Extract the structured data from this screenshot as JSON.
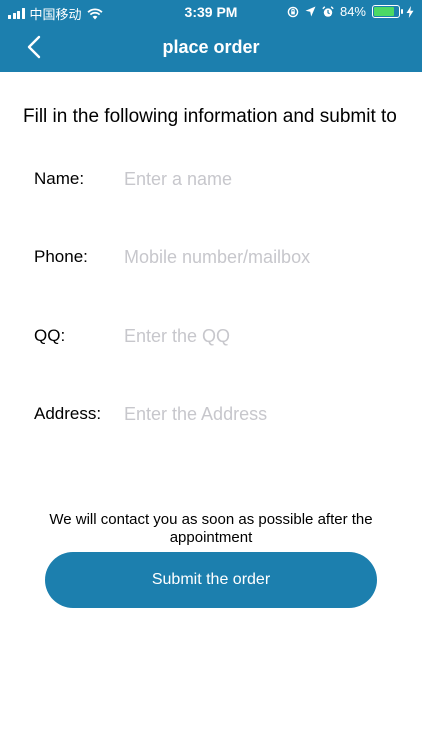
{
  "status_bar": {
    "carrier": "中国移动",
    "time": "3:39 PM",
    "battery": "84%",
    "battery_level": 0.84
  },
  "navbar": {
    "title": "place order",
    "back_icon": "chevron-left-icon"
  },
  "form": {
    "intro": "Fill in the following information and submit to",
    "fields": [
      {
        "label": "Name:",
        "placeholder": "Enter a name"
      },
      {
        "label": "Phone:",
        "placeholder": "Mobile number/mailbox"
      },
      {
        "label": "QQ:",
        "placeholder": "Enter the QQ"
      },
      {
        "label": "Address:",
        "placeholder": "Enter the Address"
      }
    ],
    "notice": "We will contact you as soon as possible after the appointment",
    "submit_label": "Submit the order"
  },
  "colors": {
    "primary": "#1c7fae",
    "battery": "#4cd964",
    "placeholder": "#c7c7cc"
  }
}
